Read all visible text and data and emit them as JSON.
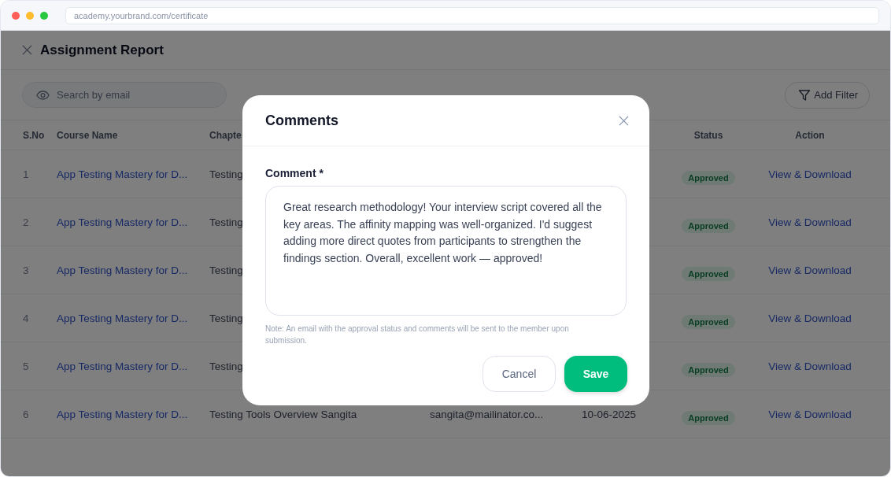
{
  "browser": {
    "url": "academy.yourbrand.com/certificate"
  },
  "page": {
    "title": "Assignment Report"
  },
  "search": {
    "placeholder": "Search by email"
  },
  "filter_button": {
    "label": "Add Filter"
  },
  "table": {
    "columns": [
      {
        "label": "S.No"
      },
      {
        "label": "Course Name"
      },
      {
        "label": "Chapte"
      },
      {},
      {},
      {
        "label": "Status"
      },
      {
        "label": "Action"
      }
    ],
    "rows": [
      {
        "sno": "1",
        "course": "App Testing Mastery for D...",
        "chapter": "Testing",
        "status": "Approved",
        "action": "View & Download"
      },
      {
        "sno": "2",
        "course": "App Testing Mastery for D...",
        "chapter": "Testing",
        "status": "Approved",
        "action": "View & Download"
      },
      {
        "sno": "3",
        "course": "App Testing Mastery for D...",
        "chapter": "Testing",
        "status": "Approved",
        "action": "View & Download"
      },
      {
        "sno": "4",
        "course": "App Testing Mastery for D...",
        "chapter": "Testing",
        "status": "Approved",
        "action": "View & Download"
      },
      {
        "sno": "5",
        "course": "App Testing Mastery for D...",
        "chapter": "Testing",
        "status": "Approved",
        "action": "View & Download"
      },
      {
        "sno": "6",
        "course": "App Testing Mastery for D...",
        "chapter": "Testing Tools Overview Sangita",
        "email": "sangita@mailinator.co...",
        "date": "10-06-2025",
        "status": "Approved",
        "action": "View & Download"
      }
    ]
  },
  "modal": {
    "title": "Comments",
    "field_label": "Comment *",
    "comment": "Great research methodology! Your interview script covered all the key areas. The affinity mapping was well-organized. I'd suggest adding more direct quotes from participants to strengthen the findings section. Overall, excellent work — approved!",
    "note": "Note: An email with the approval status and comments will be sent to the member upon submission.",
    "buttons": [
      {
        "label": "Cancel",
        "kind": "secondary"
      },
      {
        "label": "Save",
        "kind": "primary"
      }
    ]
  }
}
